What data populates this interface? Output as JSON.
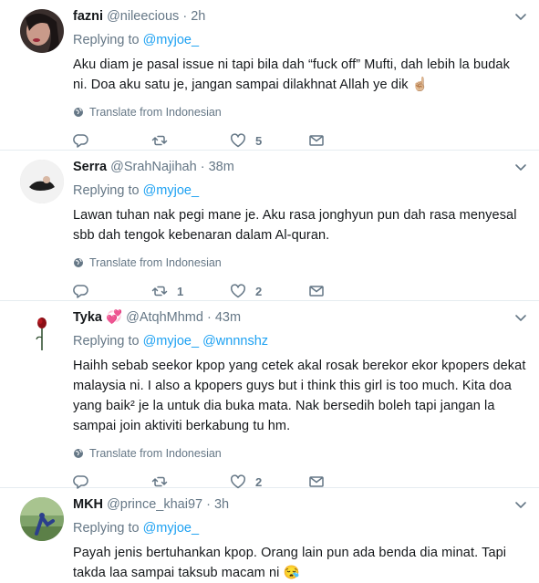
{
  "tweets": [
    {
      "name": "fazni",
      "handle": "@nileecious",
      "dot": "·",
      "time": "2h",
      "replying_label": "Replying to",
      "mentions": [
        "@myjoe_"
      ],
      "body": "Aku diam je pasal issue ni tapi bila dah “fuck off” Mufti, dah lebih la budak ni. Doa aku satu je, jangan sampai dilakhnat Allah ye dik",
      "emoji": "☝🏼",
      "translate": "Translate from Indonesian",
      "counts": {
        "reply": "",
        "retweet": "",
        "like": "5"
      }
    },
    {
      "name": "Serra",
      "handle": "@SrahNajihah",
      "dot": "·",
      "time": "38m",
      "replying_label": "Replying to",
      "mentions": [
        "@myjoe_"
      ],
      "body": "Lawan tuhan nak pegi mane je.  Aku rasa jonghyun pun dah rasa menyesal sbb dah tengok kebenaran dalam Al-quran.",
      "emoji": "",
      "translate": "Translate from Indonesian",
      "counts": {
        "reply": "",
        "retweet": "1",
        "like": "2"
      }
    },
    {
      "name": "Tyka",
      "name_emoji": "💞",
      "handle": "@AtqhMhmd",
      "dot": "·",
      "time": "43m",
      "replying_label": "Replying to",
      "mentions": [
        "@myjoe_",
        "@wnnnshz"
      ],
      "body": "Haihh sebab seekor kpop yang cetek akal rosak berekor ekor kpopers dekat malaysia ni. I also a kpopers guys but i think this girl is too much. Kita doa yang baik² je la untuk dia buka mata. Nak bersedih boleh tapi jangan la sampai join aktiviti berkabung tu hm.",
      "emoji": "",
      "translate": "Translate from Indonesian",
      "counts": {
        "reply": "",
        "retweet": "",
        "like": "2"
      }
    },
    {
      "name": "MKH",
      "handle": "@prince_khai97",
      "dot": "·",
      "time": "3h",
      "replying_label": "Replying to",
      "mentions": [
        "@myjoe_"
      ],
      "body": "Payah jenis bertuhankan kpop. Orang lain pun ada benda dia minat. Tapi takda laa sampai taksub macam ni",
      "emoji": "😪"
    }
  ],
  "icons": {
    "caret": "chevron-down-icon",
    "globe": "globe-icon",
    "reply": "reply-icon",
    "retweet": "retweet-icon",
    "like": "heart-icon",
    "dm": "envelope-icon"
  },
  "colors": {
    "link": "#1da1f2",
    "muted": "#657786",
    "text": "#14171a",
    "divider": "#e6ecf0"
  }
}
